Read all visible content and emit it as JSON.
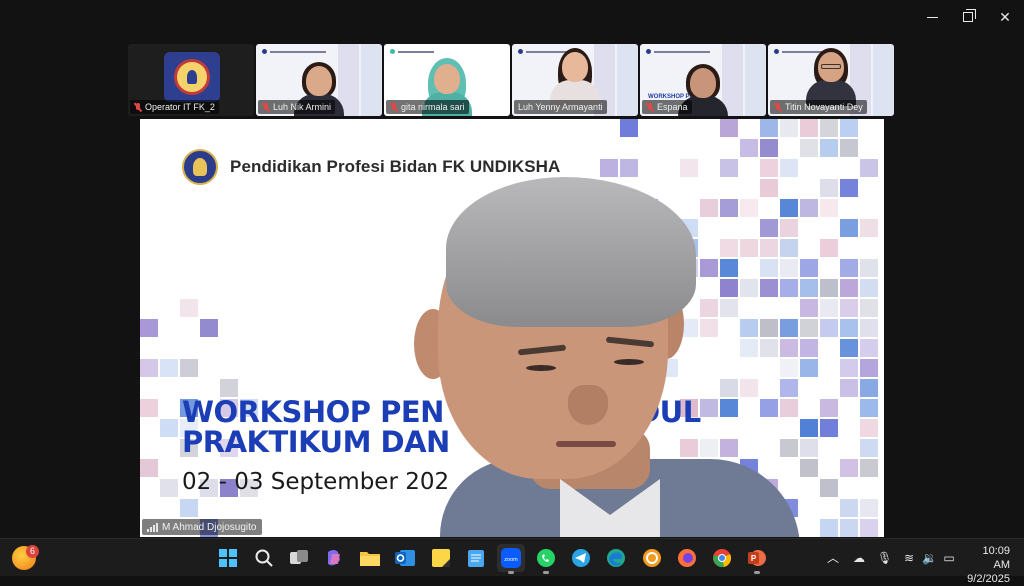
{
  "window": {
    "controls": {
      "minimize": "minimize",
      "maximize": "maximize",
      "close": "close"
    }
  },
  "participants": [
    {
      "name": "Operator IT FK_2",
      "muted": true,
      "kind": "logo"
    },
    {
      "name": "Luh Nik Armini",
      "muted": true,
      "kind": "person"
    },
    {
      "name": "gita nirmala sari",
      "muted": true,
      "kind": "hijab"
    },
    {
      "name": "Luh Yenny Armayanti",
      "muted": false,
      "kind": "person"
    },
    {
      "name": "Espana",
      "muted": true,
      "kind": "person"
    },
    {
      "name": "Titin Novayanti Dey",
      "muted": true,
      "kind": "glasses"
    }
  ],
  "slide": {
    "brand": "Pendidikan Profesi Bidan FK UNDIKSHA",
    "title_line1": "WORKSHOP PEN",
    "title_line1_end": "ODUL",
    "title_line2": "PRAKTIKUM DAN",
    "date": "02 - 03  September 2025",
    "date_visible": "02 - 03  September 202"
  },
  "speaker": {
    "name": "M Ahmad Djojosugito"
  },
  "taskbar": {
    "weather_badge": "6",
    "apps": [
      "windows-start",
      "search",
      "task-view",
      "copilot",
      "file-explorer",
      "outlook",
      "sticky-notes",
      "notepad",
      "zoom",
      "whatsapp",
      "telegram",
      "edge",
      "cake",
      "firefox",
      "chrome",
      "powerpoint"
    ],
    "clock_time": "10:09 AM",
    "clock_date": "9/2/2025"
  },
  "colors": {
    "slide_title": "#1b3db5",
    "mosaic_purple": "#7b6fc4",
    "mosaic_blue": "#4e7fd6",
    "taskbar": "#1c1c1c"
  }
}
